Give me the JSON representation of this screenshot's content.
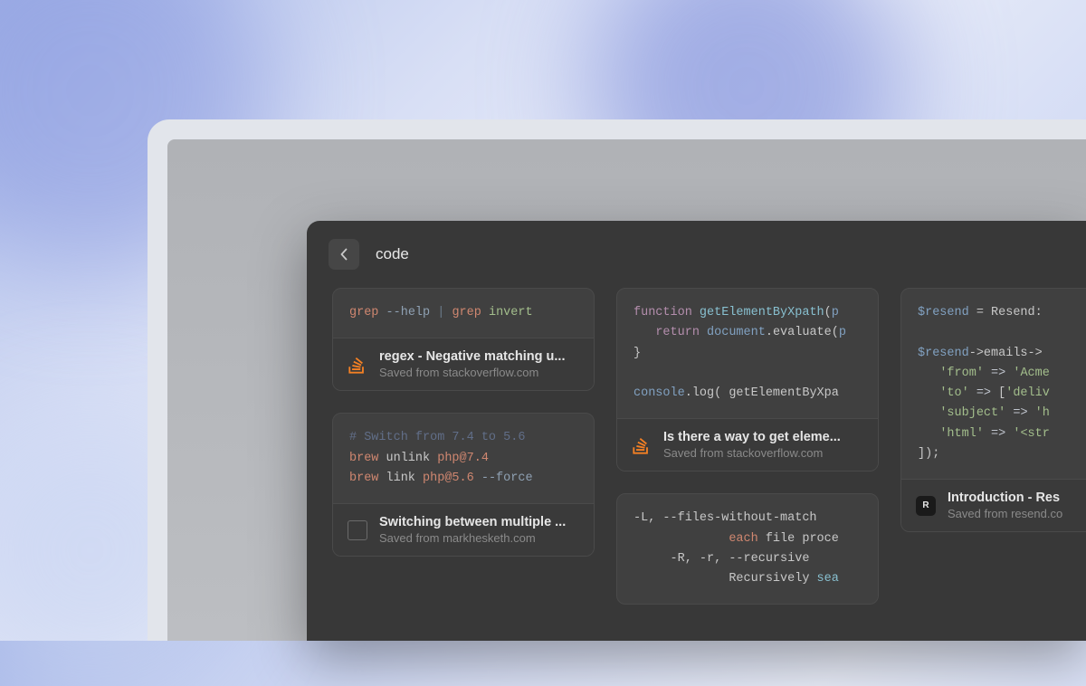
{
  "header": {
    "search_value": "code"
  },
  "cards": [
    {
      "title": "regex - Negative matching u...",
      "source": "Saved from stackoverflow.com",
      "icon": "stackoverflow",
      "code_tokens": [
        {
          "t": "grep",
          "c": "cmd"
        },
        {
          "t": " "
        },
        {
          "t": "--help",
          "c": "arg"
        },
        {
          "t": " "
        },
        {
          "t": "|",
          "c": "pipe"
        },
        {
          "t": " "
        },
        {
          "t": "grep",
          "c": "cmd"
        },
        {
          "t": " "
        },
        {
          "t": "invert",
          "c": "str"
        }
      ]
    },
    {
      "title": "Switching between multiple ...",
      "source": "Saved from markhesketh.com",
      "icon": "empty",
      "code_tokens": [
        {
          "t": "# Switch from 7.4 to 5.6",
          "c": "cmt"
        },
        {
          "t": "\n"
        },
        {
          "t": "brew",
          "c": "cmd"
        },
        {
          "t": " unlink "
        },
        {
          "t": "php@7.4",
          "c": "num"
        },
        {
          "t": "\n"
        },
        {
          "t": "brew",
          "c": "cmd"
        },
        {
          "t": " link "
        },
        {
          "t": "php@5.6",
          "c": "num"
        },
        {
          "t": " "
        },
        {
          "t": "--force",
          "c": "arg"
        }
      ]
    },
    {
      "title": "Is there a way to get eleme...",
      "source": "Saved from stackoverflow.com",
      "icon": "stackoverflow",
      "code_tokens": [
        {
          "t": "function",
          "c": "kw"
        },
        {
          "t": " "
        },
        {
          "t": "getElementByXpath",
          "c": "fn"
        },
        {
          "t": "("
        },
        {
          "t": "p",
          "c": "var"
        },
        {
          "t": "\n"
        },
        {
          "t": "   "
        },
        {
          "t": "return",
          "c": "kw"
        },
        {
          "t": " "
        },
        {
          "t": "document",
          "c": "var"
        },
        {
          "t": ".evaluate("
        },
        {
          "t": "p",
          "c": "var"
        },
        {
          "t": "\n"
        },
        {
          "t": "}\n\n"
        },
        {
          "t": "console",
          "c": "var"
        },
        {
          "t": ".log( getElementByXpa"
        }
      ]
    },
    {
      "title": "",
      "source": "",
      "icon": "none",
      "code_tokens": [
        {
          "t": "-L, --files-without-match\n"
        },
        {
          "t": "             "
        },
        {
          "t": "each",
          "c": "cmd"
        },
        {
          "t": " file proce\n"
        },
        {
          "t": "     -R, -r, --recursive\n"
        },
        {
          "t": "             Recursively "
        },
        {
          "t": "sea",
          "c": "fn"
        }
      ]
    },
    {
      "title": "Introduction - Res",
      "source": "Saved from resend.co",
      "icon": "resend",
      "code_tokens": [
        {
          "t": "$resend",
          "c": "var"
        },
        {
          "t": " = Resend:\n\n"
        },
        {
          "t": "$resend",
          "c": "var"
        },
        {
          "t": "->emails->\n"
        },
        {
          "t": "   "
        },
        {
          "t": "'from'",
          "c": "str"
        },
        {
          "t": " "
        },
        {
          "t": "=>",
          "c": "op"
        },
        {
          "t": " "
        },
        {
          "t": "'Acme",
          "c": "str"
        },
        {
          "t": "\n"
        },
        {
          "t": "   "
        },
        {
          "t": "'to'",
          "c": "str"
        },
        {
          "t": " "
        },
        {
          "t": "=>",
          "c": "op"
        },
        {
          "t": " ["
        },
        {
          "t": "'deliv",
          "c": "str"
        },
        {
          "t": "\n"
        },
        {
          "t": "   "
        },
        {
          "t": "'subject'",
          "c": "str"
        },
        {
          "t": " "
        },
        {
          "t": "=>",
          "c": "op"
        },
        {
          "t": " "
        },
        {
          "t": "'h",
          "c": "str"
        },
        {
          "t": "\n"
        },
        {
          "t": "   "
        },
        {
          "t": "'html'",
          "c": "str"
        },
        {
          "t": " "
        },
        {
          "t": "=>",
          "c": "op"
        },
        {
          "t": " "
        },
        {
          "t": "'<str",
          "c": "str"
        },
        {
          "t": "\n"
        },
        {
          "t": "]);"
        }
      ]
    }
  ]
}
